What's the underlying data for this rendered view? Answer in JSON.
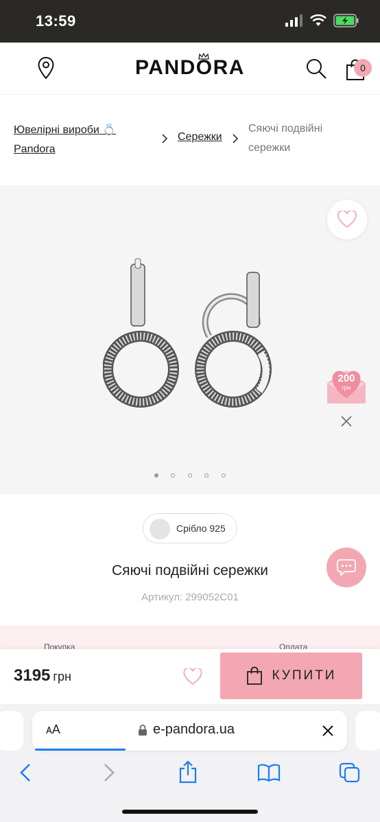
{
  "status": {
    "time": "13:59"
  },
  "header": {
    "logo": "PANDORA",
    "cart_count": "0"
  },
  "breadcrumb": {
    "items": [
      {
        "label_line1": "Ювелірні вироби 💍",
        "label_line2": "Pandora"
      },
      {
        "label": "Сережки"
      },
      {
        "label_line1": "Сяючі подвійні",
        "label_line2": "сережки"
      }
    ]
  },
  "gallery": {
    "active_index": 0,
    "count": 5
  },
  "promo_badge": {
    "amount": "200",
    "unit": "грн"
  },
  "product": {
    "material": "Срібло 925",
    "title": "Сяючі подвійні сережки",
    "sku": "Артикул: 299052C01"
  },
  "strip": {
    "left": "Покупка",
    "right": "Оплата"
  },
  "buy": {
    "price": "3195",
    "currency": "грн",
    "button_label": "КУПИТИ"
  },
  "browser": {
    "text_size": "ᴀA",
    "url": "e-pandora.ua"
  },
  "colors": {
    "accent_pink": "#f2a7b3",
    "status_bg": "#2a2926",
    "link_blue": "#1e7cf2"
  }
}
